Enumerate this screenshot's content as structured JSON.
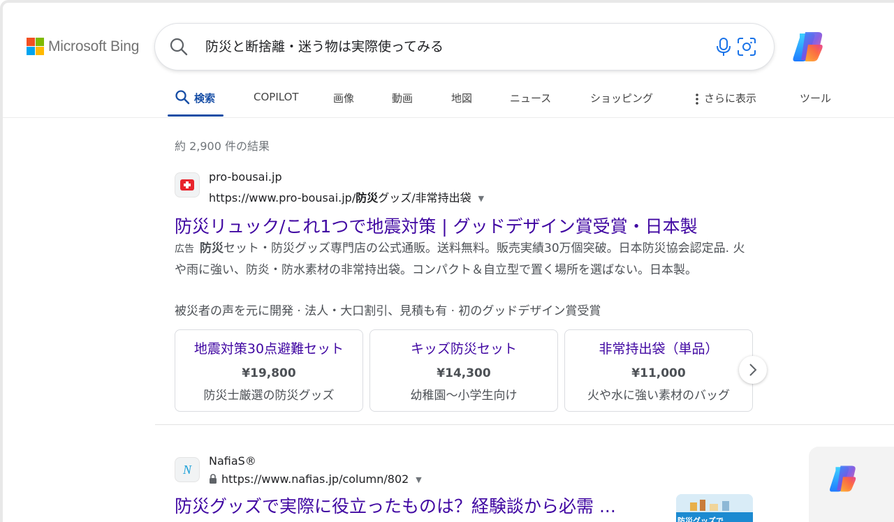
{
  "brand": {
    "name": "Microsoft Bing"
  },
  "search": {
    "query": "防災と断捨離・迷う物は実際使ってみる"
  },
  "tabs": [
    {
      "label": "検索",
      "active": true
    },
    {
      "label": "COPILOT"
    },
    {
      "label": "画像"
    },
    {
      "label": "動画"
    },
    {
      "label": "地図"
    },
    {
      "label": "ニュース"
    },
    {
      "label": "ショッピング"
    },
    {
      "label": "さらに表示"
    },
    {
      "label": "ツール"
    }
  ],
  "result_count": "約 2,900 件の結果",
  "results": [
    {
      "site": "pro-bousai.jp",
      "url_prefix": "https://www.pro-bousai.jp/",
      "url_bold": "防災",
      "url_suffix": "グッズ/非常持出袋",
      "title": "防災リュック/これ1つで地震対策 | グッドデザイン賞受賞・日本製",
      "ad_label": "広告",
      "snippet_bold": "防災",
      "snippet_rest": "セット・防災グッズ専門店の公式通販。送料無料。販売実績30万個突破。日本防災協会認定品. 火や雨に強い、防炎・防水素材の非常持出袋。コンパクト＆自立型で置く場所を選ばない。日本製。",
      "snippet_line2": "被災者の声を元に開発 · 法人・大口割引、見積も有 · 初のグッドデザイン賞受賞",
      "cards": [
        {
          "title": "地震対策30点避難セット",
          "price": "¥19,800",
          "desc": "防災士厳選の防災グッズ"
        },
        {
          "title": "キッズ防災セット",
          "price": "¥14,300",
          "desc": "幼稚園～小学生向け"
        },
        {
          "title": "非常持出袋（単品）",
          "price": "¥11,000",
          "desc": "火や水に強い素材のバッグ"
        }
      ]
    },
    {
      "site": "NafiaS®",
      "favicon_letter": "N",
      "url": "https://www.nafias.jp/column/802",
      "title": "防災グッズで実際に役立ったものは？経験談から必需 ...",
      "thumb_text": "防災グッズで"
    }
  ],
  "colors": {
    "accent": "#174ea6",
    "visited_link": "#4007a2",
    "bing_red_favicon": "#e8242c"
  },
  "icons": [
    "search-icon",
    "microphone-icon",
    "visual-search-icon",
    "copilot-icon",
    "chevron-right-icon",
    "lock-icon"
  ]
}
